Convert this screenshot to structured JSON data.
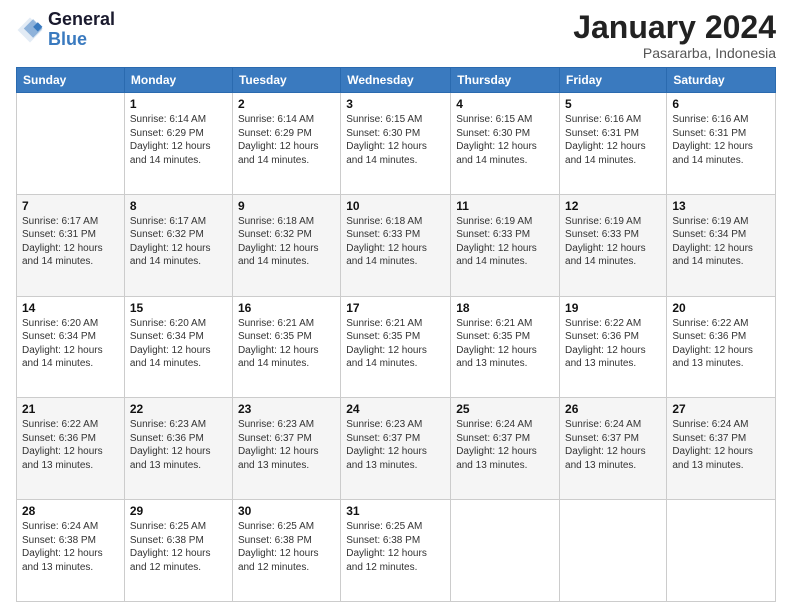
{
  "logo": {
    "line1": "General",
    "line2": "Blue"
  },
  "title": "January 2024",
  "subtitle": "Pasararba, Indonesia",
  "days_header": [
    "Sunday",
    "Monday",
    "Tuesday",
    "Wednesday",
    "Thursday",
    "Friday",
    "Saturday"
  ],
  "weeks": [
    [
      {
        "day": "",
        "sunrise": "",
        "sunset": "",
        "daylight": ""
      },
      {
        "day": "1",
        "sunrise": "Sunrise: 6:14 AM",
        "sunset": "Sunset: 6:29 PM",
        "daylight": "Daylight: 12 hours and 14 minutes."
      },
      {
        "day": "2",
        "sunrise": "Sunrise: 6:14 AM",
        "sunset": "Sunset: 6:29 PM",
        "daylight": "Daylight: 12 hours and 14 minutes."
      },
      {
        "day": "3",
        "sunrise": "Sunrise: 6:15 AM",
        "sunset": "Sunset: 6:30 PM",
        "daylight": "Daylight: 12 hours and 14 minutes."
      },
      {
        "day": "4",
        "sunrise": "Sunrise: 6:15 AM",
        "sunset": "Sunset: 6:30 PM",
        "daylight": "Daylight: 12 hours and 14 minutes."
      },
      {
        "day": "5",
        "sunrise": "Sunrise: 6:16 AM",
        "sunset": "Sunset: 6:31 PM",
        "daylight": "Daylight: 12 hours and 14 minutes."
      },
      {
        "day": "6",
        "sunrise": "Sunrise: 6:16 AM",
        "sunset": "Sunset: 6:31 PM",
        "daylight": "Daylight: 12 hours and 14 minutes."
      }
    ],
    [
      {
        "day": "7",
        "sunrise": "Sunrise: 6:17 AM",
        "sunset": "Sunset: 6:31 PM",
        "daylight": "Daylight: 12 hours and 14 minutes."
      },
      {
        "day": "8",
        "sunrise": "Sunrise: 6:17 AM",
        "sunset": "Sunset: 6:32 PM",
        "daylight": "Daylight: 12 hours and 14 minutes."
      },
      {
        "day": "9",
        "sunrise": "Sunrise: 6:18 AM",
        "sunset": "Sunset: 6:32 PM",
        "daylight": "Daylight: 12 hours and 14 minutes."
      },
      {
        "day": "10",
        "sunrise": "Sunrise: 6:18 AM",
        "sunset": "Sunset: 6:33 PM",
        "daylight": "Daylight: 12 hours and 14 minutes."
      },
      {
        "day": "11",
        "sunrise": "Sunrise: 6:19 AM",
        "sunset": "Sunset: 6:33 PM",
        "daylight": "Daylight: 12 hours and 14 minutes."
      },
      {
        "day": "12",
        "sunrise": "Sunrise: 6:19 AM",
        "sunset": "Sunset: 6:33 PM",
        "daylight": "Daylight: 12 hours and 14 minutes."
      },
      {
        "day": "13",
        "sunrise": "Sunrise: 6:19 AM",
        "sunset": "Sunset: 6:34 PM",
        "daylight": "Daylight: 12 hours and 14 minutes."
      }
    ],
    [
      {
        "day": "14",
        "sunrise": "Sunrise: 6:20 AM",
        "sunset": "Sunset: 6:34 PM",
        "daylight": "Daylight: 12 hours and 14 minutes."
      },
      {
        "day": "15",
        "sunrise": "Sunrise: 6:20 AM",
        "sunset": "Sunset: 6:34 PM",
        "daylight": "Daylight: 12 hours and 14 minutes."
      },
      {
        "day": "16",
        "sunrise": "Sunrise: 6:21 AM",
        "sunset": "Sunset: 6:35 PM",
        "daylight": "Daylight: 12 hours and 14 minutes."
      },
      {
        "day": "17",
        "sunrise": "Sunrise: 6:21 AM",
        "sunset": "Sunset: 6:35 PM",
        "daylight": "Daylight: 12 hours and 14 minutes."
      },
      {
        "day": "18",
        "sunrise": "Sunrise: 6:21 AM",
        "sunset": "Sunset: 6:35 PM",
        "daylight": "Daylight: 12 hours and 13 minutes."
      },
      {
        "day": "19",
        "sunrise": "Sunrise: 6:22 AM",
        "sunset": "Sunset: 6:36 PM",
        "daylight": "Daylight: 12 hours and 13 minutes."
      },
      {
        "day": "20",
        "sunrise": "Sunrise: 6:22 AM",
        "sunset": "Sunset: 6:36 PM",
        "daylight": "Daylight: 12 hours and 13 minutes."
      }
    ],
    [
      {
        "day": "21",
        "sunrise": "Sunrise: 6:22 AM",
        "sunset": "Sunset: 6:36 PM",
        "daylight": "Daylight: 12 hours and 13 minutes."
      },
      {
        "day": "22",
        "sunrise": "Sunrise: 6:23 AM",
        "sunset": "Sunset: 6:36 PM",
        "daylight": "Daylight: 12 hours and 13 minutes."
      },
      {
        "day": "23",
        "sunrise": "Sunrise: 6:23 AM",
        "sunset": "Sunset: 6:37 PM",
        "daylight": "Daylight: 12 hours and 13 minutes."
      },
      {
        "day": "24",
        "sunrise": "Sunrise: 6:23 AM",
        "sunset": "Sunset: 6:37 PM",
        "daylight": "Daylight: 12 hours and 13 minutes."
      },
      {
        "day": "25",
        "sunrise": "Sunrise: 6:24 AM",
        "sunset": "Sunset: 6:37 PM",
        "daylight": "Daylight: 12 hours and 13 minutes."
      },
      {
        "day": "26",
        "sunrise": "Sunrise: 6:24 AM",
        "sunset": "Sunset: 6:37 PM",
        "daylight": "Daylight: 12 hours and 13 minutes."
      },
      {
        "day": "27",
        "sunrise": "Sunrise: 6:24 AM",
        "sunset": "Sunset: 6:37 PM",
        "daylight": "Daylight: 12 hours and 13 minutes."
      }
    ],
    [
      {
        "day": "28",
        "sunrise": "Sunrise: 6:24 AM",
        "sunset": "Sunset: 6:38 PM",
        "daylight": "Daylight: 12 hours and 13 minutes."
      },
      {
        "day": "29",
        "sunrise": "Sunrise: 6:25 AM",
        "sunset": "Sunset: 6:38 PM",
        "daylight": "Daylight: 12 hours and 12 minutes."
      },
      {
        "day": "30",
        "sunrise": "Sunrise: 6:25 AM",
        "sunset": "Sunset: 6:38 PM",
        "daylight": "Daylight: 12 hours and 12 minutes."
      },
      {
        "day": "31",
        "sunrise": "Sunrise: 6:25 AM",
        "sunset": "Sunset: 6:38 PM",
        "daylight": "Daylight: 12 hours and 12 minutes."
      },
      {
        "day": "",
        "sunrise": "",
        "sunset": "",
        "daylight": ""
      },
      {
        "day": "",
        "sunrise": "",
        "sunset": "",
        "daylight": ""
      },
      {
        "day": "",
        "sunrise": "",
        "sunset": "",
        "daylight": ""
      }
    ]
  ]
}
